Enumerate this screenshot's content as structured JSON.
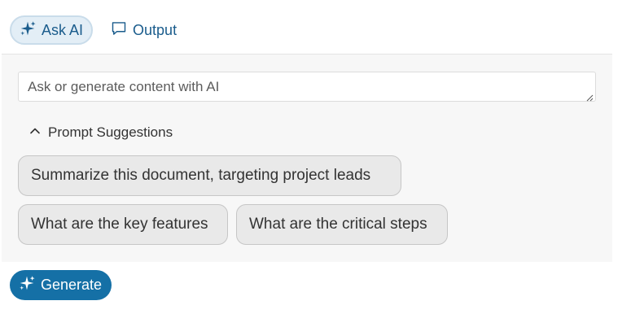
{
  "tabs": [
    {
      "label": "Ask AI",
      "icon": "sparkles-icon",
      "active": true
    },
    {
      "label": "Output",
      "icon": "speech-bubble-icon",
      "active": false
    }
  ],
  "prompt": {
    "value": "",
    "placeholder": "Ask or generate content with AI"
  },
  "suggestions": {
    "toggle_label": "Prompt Suggestions",
    "toggle_icon": "chevron-up-icon",
    "expanded": true,
    "items": [
      {
        "label": "Summarize this document, targeting project leads"
      },
      {
        "label": "What are the key features"
      },
      {
        "label": "What are the critical steps"
      }
    ]
  },
  "generate": {
    "label": "Generate",
    "icon": "sparkles-icon"
  },
  "colors": {
    "accent": "#1570a6",
    "tab_text": "#1a5c8c",
    "tab_active_bg": "#e3eef6",
    "panel_bg": "#f7f7f7",
    "chip_bg": "#e9e9e9"
  }
}
